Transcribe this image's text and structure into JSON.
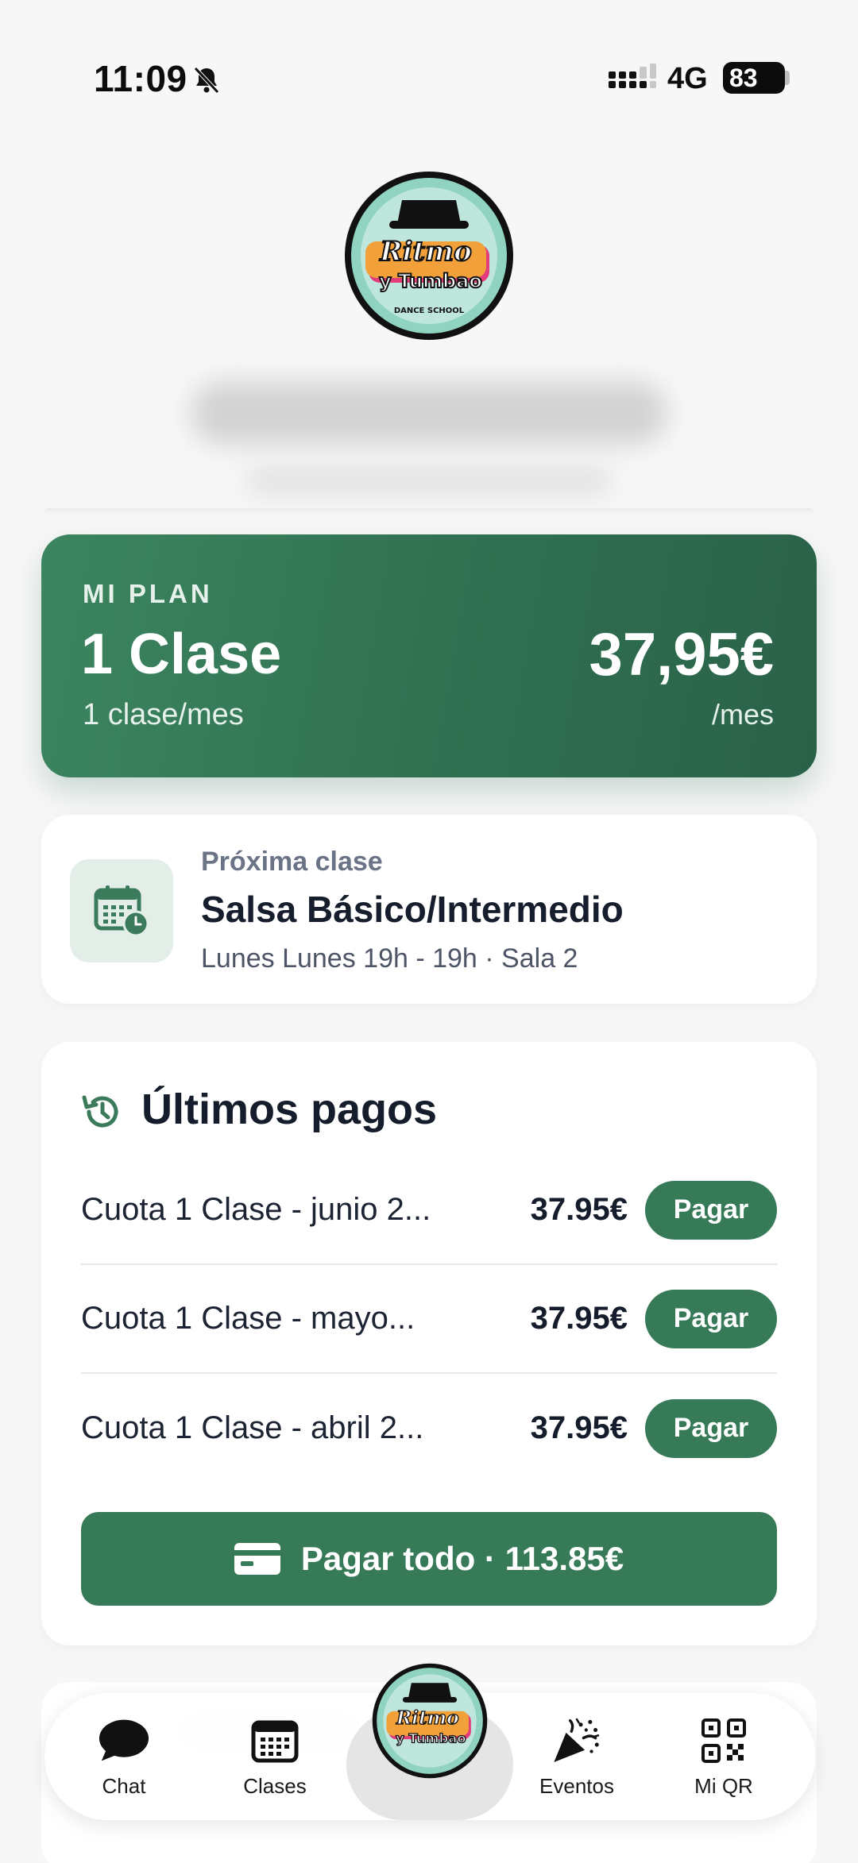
{
  "status_bar": {
    "time": "11:09",
    "network": "4G",
    "battery": "83"
  },
  "header": {
    "logo_line1": "Ritmo",
    "logo_line2": "y Tumbao",
    "logo_tagline": "DANCE SCHOOL"
  },
  "plan": {
    "label": "MI PLAN",
    "name": "1 Clase",
    "frequency": "1 clase/mes",
    "price": "37,95€",
    "period": "/mes"
  },
  "next_class": {
    "label": "Próxima clase",
    "title": "Salsa Básico/Intermedio",
    "detail": "Lunes Lunes 19h - 19h · Sala 2"
  },
  "payments": {
    "title": "Últimos pagos",
    "items": [
      {
        "description": "Cuota 1 Clase - junio 2...",
        "amount": "37.95€",
        "button": "Pagar"
      },
      {
        "description": "Cuota 1 Clase - mayo...",
        "amount": "37.95€",
        "button": "Pagar"
      },
      {
        "description": "Cuota 1 Clase - abril 2...",
        "amount": "37.95€",
        "button": "Pagar"
      }
    ],
    "pay_all_label": "Pagar todo · 113.85€"
  },
  "tab_bar": {
    "items": [
      {
        "label": "Chat",
        "icon": "chat-bubble-icon"
      },
      {
        "label": "Clases",
        "icon": "calendar-icon"
      },
      {
        "label": "",
        "icon": "school-logo"
      },
      {
        "label": "Eventos",
        "icon": "party-popper-icon"
      },
      {
        "label": "Mi QR",
        "icon": "qr-code-icon"
      }
    ]
  },
  "colors": {
    "primary": "#367a58",
    "plan_gradient_start": "#3c8560",
    "plan_gradient_end": "#2a6249",
    "background": "#f7f7f7"
  }
}
